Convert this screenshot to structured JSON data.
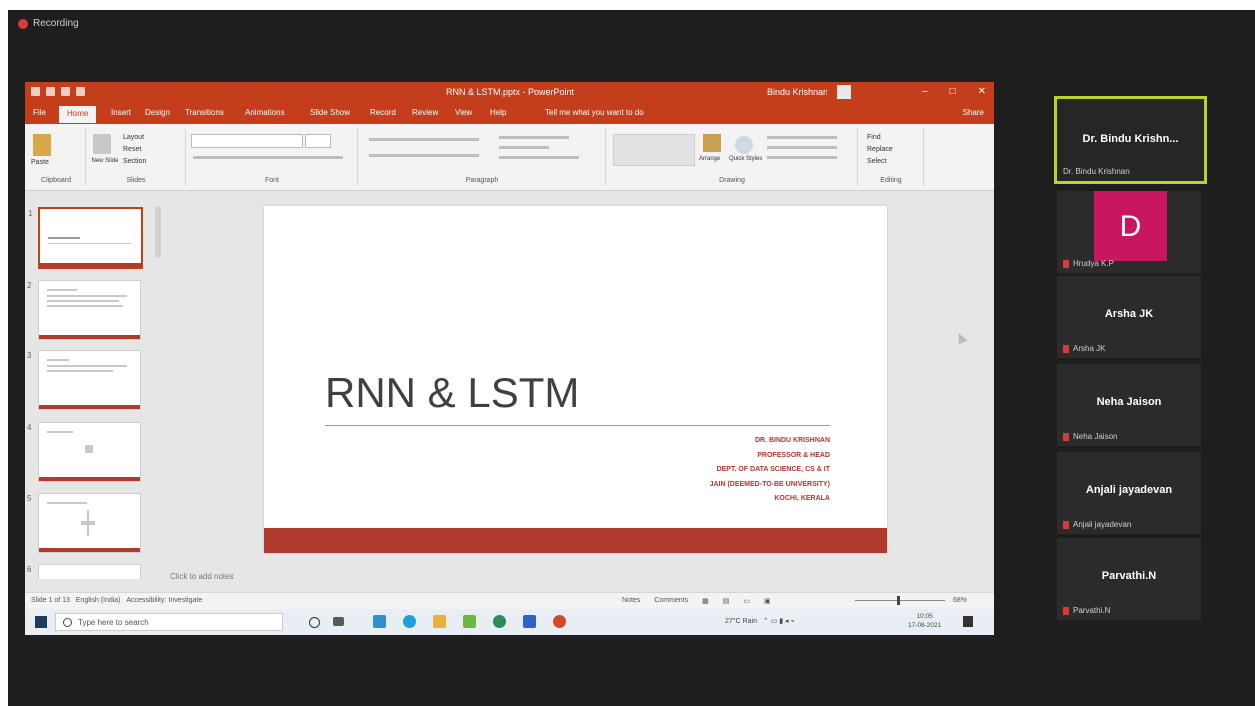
{
  "recording": {
    "label": "Recording"
  },
  "ppt": {
    "window_title": "RNN & LSTM.pptx - PowerPoint",
    "user_name": "Bindu Krishnan",
    "tabs": [
      "File",
      "Home",
      "Insert",
      "Design",
      "Transitions",
      "Animations",
      "Slide Show",
      "Record",
      "Review",
      "View",
      "Help"
    ],
    "tell_me": "Tell me what you want to do",
    "share": "Share",
    "ribbon_groups": [
      "Clipboard",
      "Slides",
      "Font",
      "Paragraph",
      "Drawing",
      "Editing"
    ],
    "ribbon_buttons": {
      "paste": "Paste",
      "new_slide": "New Slide",
      "layout": "Layout",
      "reset": "Reset",
      "section": "Section",
      "arrange": "Arrange",
      "quick_styles": "Quick Styles",
      "find": "Find",
      "replace": "Replace",
      "select": "Select"
    },
    "thumbnails": [
      "1",
      "2",
      "3",
      "4",
      "5",
      "6"
    ],
    "slide": {
      "title": "RNN & LSTM",
      "subtitle_lines": [
        "DR. BINDU KRISHNAN",
        "PROFESSOR & HEAD",
        "DEPT. OF DATA SCIENCE, CS & IT",
        "JAIN (DEEMED-TO-BE UNIVERSITY)",
        "KOCHI, KERALA"
      ]
    },
    "notes_placeholder": "Click to add notes",
    "status": {
      "slide_info": "Slide 1 of 13",
      "language": "English (India)",
      "accessibility": "Accessibility: Investigate",
      "notes": "Notes",
      "comments": "Comments",
      "zoom": "68%"
    }
  },
  "taskbar": {
    "search_placeholder": "Type here to search",
    "weather": "27°C Rain",
    "time": "10:05",
    "date": "17-08-2021"
  },
  "participants": [
    {
      "tile_name": "Dr. Bindu Krishn...",
      "label": "Dr. Bindu Krishnan",
      "active": true
    },
    {
      "avatar_letter": "D",
      "label": "Hrudya K.P"
    },
    {
      "tile_name": "Arsha JK",
      "label": "Arsha JK"
    },
    {
      "tile_name": "Neha Jaison",
      "label": "Neha Jaison"
    },
    {
      "tile_name": "Anjali jayadevan",
      "label": "Anjali jayadevan"
    },
    {
      "tile_name": "Parvathi.N",
      "label": "Parvathi.N"
    }
  ],
  "colors": {
    "ppt_accent": "#c43e1c",
    "slide_red": "#b03a2e",
    "active_border": "#b8d42a",
    "avatar": "#c8175e"
  }
}
